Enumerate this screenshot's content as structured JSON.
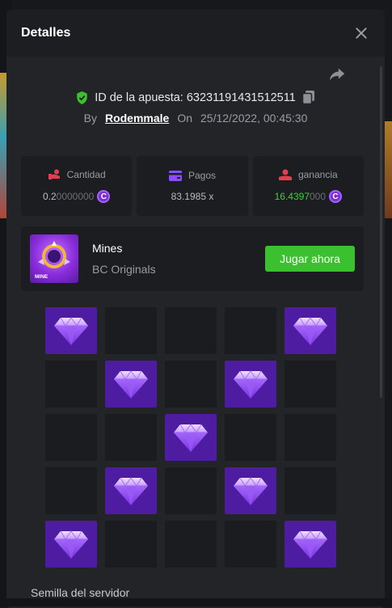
{
  "modal": {
    "title": "Detalles"
  },
  "bet": {
    "id_label": "ID de la apuesta: 63231191431512511",
    "by_label": "By",
    "user": "Rodemmale",
    "on_label": "On",
    "datetime": "25/12/2022, 00:45:30"
  },
  "stats": {
    "cantidad": {
      "label": "Cantidad",
      "value_main": "0.2",
      "value_dim": "0000000"
    },
    "pagos": {
      "label": "Pagos",
      "value": "83.1985 x"
    },
    "ganancia": {
      "label": "ganancia",
      "value_main": "16.4397",
      "value_dim": "000"
    }
  },
  "coin_symbol": "C",
  "game": {
    "name": "Mines",
    "provider": "BC Originals",
    "thumb_label": "MINE",
    "play_label": "Jugar ahora"
  },
  "board": {
    "rows": 5,
    "cols": 5,
    "gems": [
      [
        1,
        0,
        0,
        0,
        1
      ],
      [
        0,
        1,
        0,
        1,
        0
      ],
      [
        0,
        0,
        1,
        0,
        0
      ],
      [
        0,
        1,
        0,
        1,
        0
      ],
      [
        1,
        0,
        0,
        0,
        1
      ]
    ]
  },
  "server_seed_label": "Semilla del servidor",
  "colors": {
    "accent_green": "#3bc12f",
    "gem_purple": "#4e1ca0",
    "profit_green": "#38d23a",
    "coin_purple": "#7a2fd6"
  }
}
